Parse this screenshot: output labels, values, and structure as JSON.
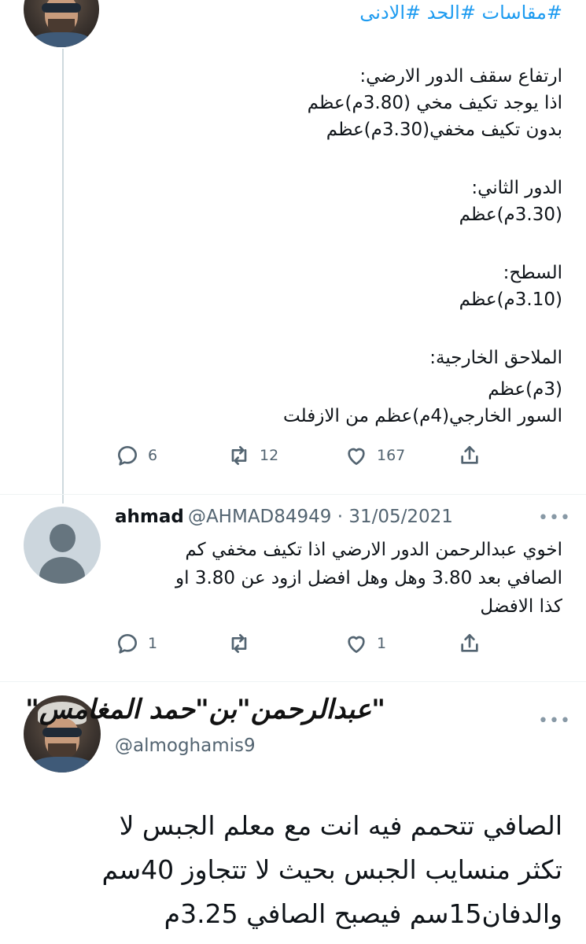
{
  "tweet1": {
    "hashtags": "#مقاسات #الحد #الادنى",
    "lines": [
      "ارتفاع سقف الدور الارضي:",
      "اذا يوجد تكيف مخي (3.80م)عظم",
      "بدون تكيف مخفي(3.30م)عظم",
      "الدور الثاني:",
      "(3.30م)عظم",
      "السطح:",
      "(3.10م)عظم",
      "الملاحق الخارجية:",
      "(3م)عظم",
      "السور الخارجي(4م)عظم من الازفلت"
    ],
    "replies": "6",
    "retweets": "12",
    "likes": "167"
  },
  "reply": {
    "name": "ahmad",
    "meta": "@AHMAD84949 · 31/05/2021",
    "lines": [
      "اخوي عبدالرحمن الدور الارضي اذا تكيف مخفي كم",
      "الصافي بعد 3.80 وهل وهل افضل ازود عن 3.80 او",
      "كذا الافضل"
    ],
    "replies": "1",
    "retweets": "",
    "likes": "1"
  },
  "main": {
    "name": "\"عبدالرحمن\"بن\"حمد المغامس\"",
    "handle": "@almoghamis9",
    "lines": [
      "الصافي تتحمم فيه انت مع معلم الجبس لا",
      "تكثر منسايب الجبس بحيث لا تتجاوز 40سم",
      "والدفان15سم فيصبح الصافي 3.25م"
    ]
  },
  "icons": [
    "reply-icon",
    "retweet-icon",
    "like-icon",
    "share-icon",
    "more-icon"
  ],
  "colors": {
    "link": "#1d9bf0",
    "secondary": "#536471",
    "line": "#cfd9de"
  }
}
